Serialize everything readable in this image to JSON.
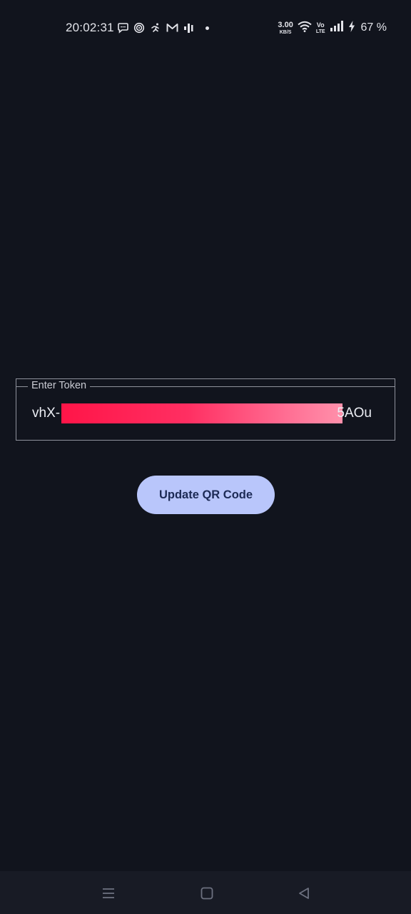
{
  "status_bar": {
    "time": "20:02:31",
    "notification_icons": [
      "chat-bubble-icon",
      "target-icon",
      "running-person-icon",
      "gmail-icon",
      "bars-chart-icon",
      "more-dot-icon"
    ],
    "net_speed_value": "3.00",
    "net_speed_unit": "KB/S",
    "volte_top": "Vo",
    "volte_bottom": "LTE",
    "battery_percent": "67 %",
    "system_icons": [
      "wifi-icon",
      "volte-icon",
      "signal-icon",
      "charging-icon"
    ]
  },
  "token_field": {
    "label": "Enter Token",
    "value_prefix": "vhX-",
    "value_suffix": "5AOu",
    "redacted": true
  },
  "update_button": {
    "label": "Update QR Code"
  },
  "nav_bar": {
    "buttons": [
      "menu-icon",
      "home-icon",
      "back-icon"
    ]
  },
  "colors": {
    "background": "#11141d",
    "button_bg": "#b9c6fb",
    "button_text": "#1c2a55",
    "outline": "#8f929c",
    "redaction": "#ff2f62"
  }
}
